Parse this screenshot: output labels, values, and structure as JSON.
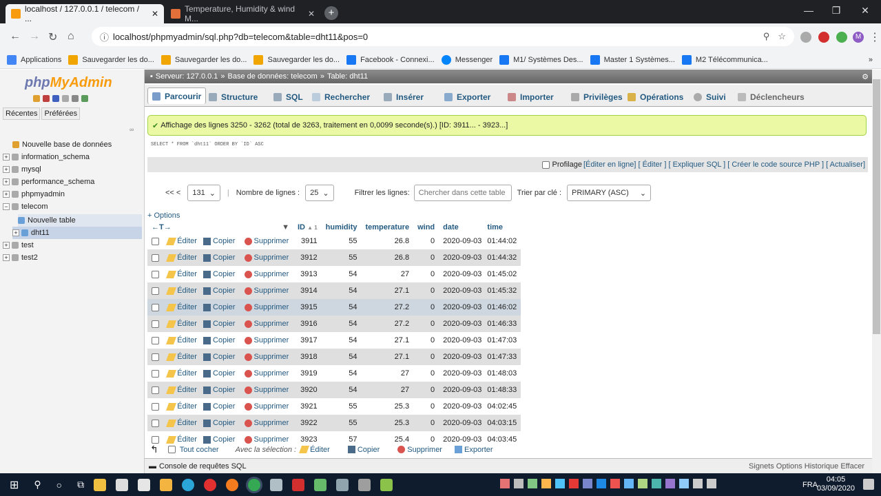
{
  "browser": {
    "tabs": [
      {
        "title": "localhost / 127.0.0.1 / telecom / ...",
        "active": true
      },
      {
        "title": "Temperature, Humidity & wind M...",
        "active": false
      }
    ],
    "url": "localhost/phpmyadmin/sql.php?db=telecom&table=dht11&pos=0",
    "profile_initial": "M",
    "bookmarks": [
      "Applications",
      "Sauvegarder les do...",
      "Sauvegarder les do...",
      "Sauvegarder les do...",
      "Facebook - Connexi...",
      "Messenger",
      "M1/ Systèmes Des...",
      "Master 1 Systèmes...",
      "M2 Télécommunica..."
    ]
  },
  "sidebar": {
    "logo_a": "php",
    "logo_b": "MyAdmin",
    "recent": "Récentes",
    "favorites": "Préférées",
    "items": [
      {
        "label": "Nouvelle base de données"
      },
      {
        "label": "information_schema"
      },
      {
        "label": "mysql"
      },
      {
        "label": "performance_schema"
      },
      {
        "label": "phpmyadmin"
      },
      {
        "label": "telecom"
      },
      {
        "label": "Nouvelle table"
      },
      {
        "label": "dht11"
      },
      {
        "label": "test"
      },
      {
        "label": "test2"
      }
    ]
  },
  "breadcrumb": {
    "server": "Serveur: 127.0.0.1",
    "db": "Base de données: telecom",
    "table": "Table: dht11"
  },
  "tabs": [
    "Parcourir",
    "Structure",
    "SQL",
    "Rechercher",
    "Insérer",
    "Exporter",
    "Importer",
    "Privilèges",
    "Opérations",
    "Suivi",
    "Déclencheurs"
  ],
  "message": "Affichage des lignes 3250 - 3262 (total de 3263, traitement en 0,0099 seconde(s).) [ID: 3911... - 3923...]",
  "sql": "SELECT * FROM `dht11` ORDER BY `ID` ASC",
  "profiling": {
    "label": "Profilage",
    "links": "[Éditer en ligne] [ Éditer ] [ Expliquer SQL ] [ Créer le code source PHP ] [ Actualiser]"
  },
  "nav": {
    "prev": "<<  <",
    "page": "131",
    "rows_label": "Nombre de lignes :",
    "rows_value": "25",
    "filter_label": "Filtrer les lignes:",
    "filter_placeholder": "Chercher dans cette table",
    "sort_label": "Trier par clé :",
    "sort_value": "PRIMARY (ASC)"
  },
  "options_link": "+ Options",
  "table": {
    "columns": [
      "ID",
      "humidity",
      "temperature",
      "wind",
      "date",
      "time"
    ],
    "actions": {
      "edit": "Éditer",
      "copy": "Copier",
      "delete": "Supprimer"
    },
    "rows": [
      [
        "3911",
        "55",
        "26.8",
        "0",
        "2020-09-03",
        "01:44:02"
      ],
      [
        "3912",
        "55",
        "26.8",
        "0",
        "2020-09-03",
        "01:44:32"
      ],
      [
        "3913",
        "54",
        "27",
        "0",
        "2020-09-03",
        "01:45:02"
      ],
      [
        "3914",
        "54",
        "27.1",
        "0",
        "2020-09-03",
        "01:45:32"
      ],
      [
        "3915",
        "54",
        "27.2",
        "0",
        "2020-09-03",
        "01:46:02"
      ],
      [
        "3916",
        "54",
        "27.2",
        "0",
        "2020-09-03",
        "01:46:33"
      ],
      [
        "3917",
        "54",
        "27.1",
        "0",
        "2020-09-03",
        "01:47:03"
      ],
      [
        "3918",
        "54",
        "27.1",
        "0",
        "2020-09-03",
        "01:47:33"
      ],
      [
        "3919",
        "54",
        "27",
        "0",
        "2020-09-03",
        "01:48:03"
      ],
      [
        "3920",
        "54",
        "27",
        "0",
        "2020-09-03",
        "01:48:33"
      ],
      [
        "3921",
        "55",
        "25.3",
        "0",
        "2020-09-03",
        "04:02:45"
      ],
      [
        "3922",
        "55",
        "25.3",
        "0",
        "2020-09-03",
        "04:03:15"
      ],
      [
        "3923",
        "57",
        "25.4",
        "0",
        "2020-09-03",
        "04:03:45"
      ]
    ]
  },
  "bulk": {
    "check_all": "Tout cocher",
    "with_selection": "Avec la sélection :",
    "edit": "Éditer",
    "copy": "Copier",
    "delete": "Supprimer",
    "export": "Exporter"
  },
  "console": {
    "title": "Console de requêtes SQL",
    "right": "Signets  Options  Historique  Effacer"
  },
  "taskbar": {
    "lang": "FRA",
    "time": "04:05",
    "date": "03/09/2020"
  },
  "colors": {
    "accent": "#235a81",
    "success_bg": "#ebf8a4",
    "taskbar": "#0f1c2e"
  }
}
